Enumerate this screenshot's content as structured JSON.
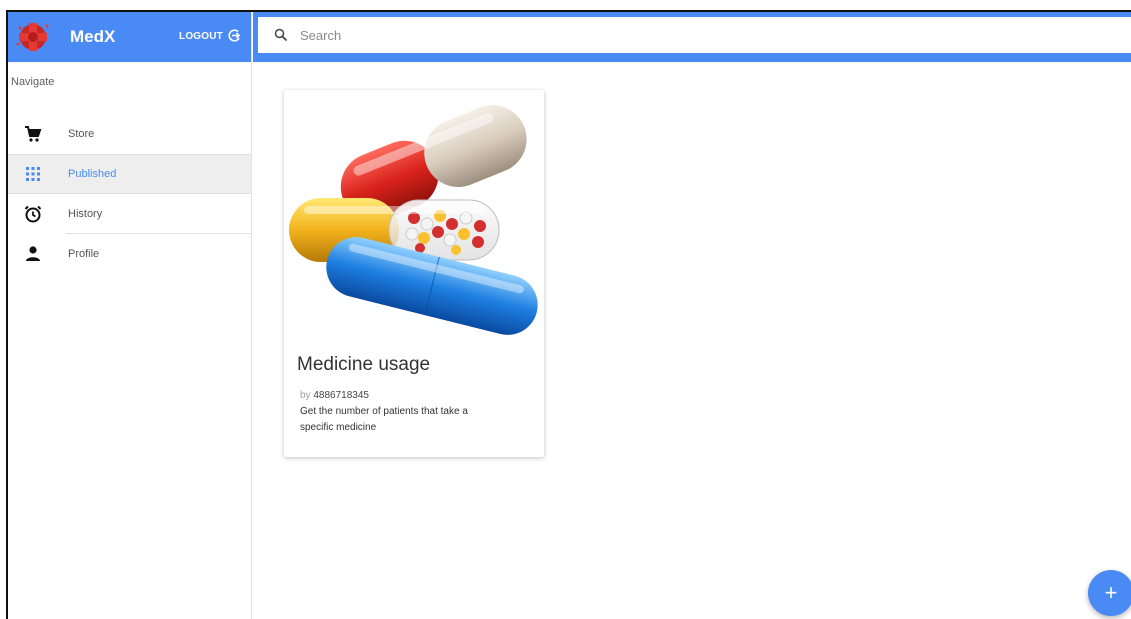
{
  "app": {
    "name": "MedX",
    "logout_label": "LOGOUT"
  },
  "search": {
    "placeholder": "Search",
    "value": ""
  },
  "sidebar": {
    "title": "Navigate",
    "items": [
      {
        "label": "Store",
        "icon": "cart-icon",
        "active": false
      },
      {
        "label": "Published",
        "icon": "grid-icon",
        "active": true
      },
      {
        "label": "History",
        "icon": "history-icon",
        "active": false
      },
      {
        "label": "Profile",
        "icon": "person-icon",
        "active": false
      }
    ]
  },
  "cards": [
    {
      "title": "Medicine usage",
      "by_label": "by",
      "author": "4886718345",
      "description": "Get the number of patients that take a specific medicine",
      "image": "pills-image"
    }
  ],
  "fab": {
    "label": "+"
  },
  "colors": {
    "primary": "#4a8af4",
    "active_bg": "#eeeeee"
  }
}
